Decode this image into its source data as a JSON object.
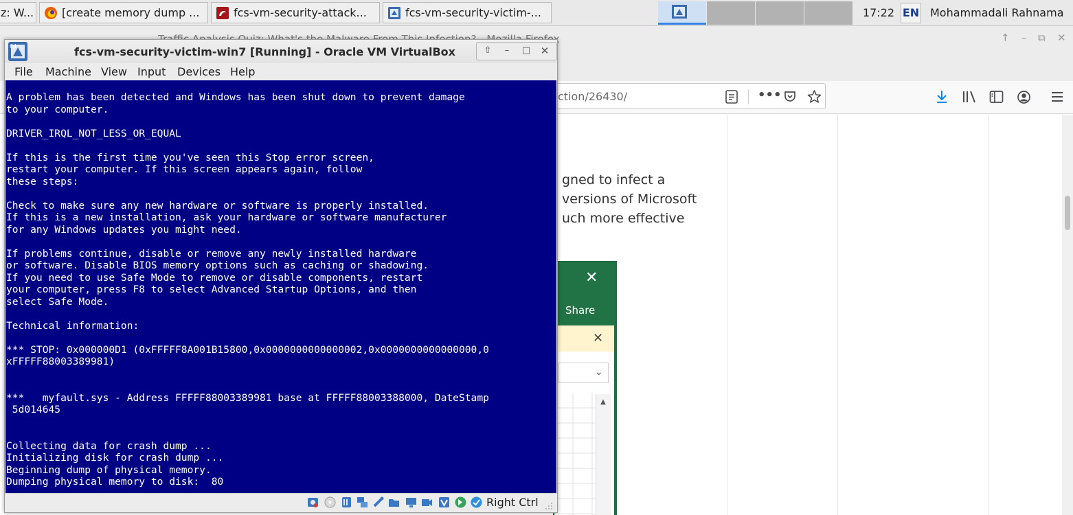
{
  "taskbar": {
    "tasks": [
      {
        "label": "z: W...",
        "icon": "window-icon"
      },
      {
        "label": "[create memory dump ...",
        "icon": "firefox-icon"
      },
      {
        "label": "fcs-vm-security-attack...",
        "icon": "kali-vm-icon"
      },
      {
        "label": "fcs-vm-security-victim-...",
        "icon": "virtualbox-icon"
      }
    ],
    "clock": "17:22",
    "lang": "EN",
    "user": "Mohammadali Rahnama"
  },
  "firefox": {
    "title": "Traffic Analysis Quiz: What's the Malware From This Infection? - Mozilla Firefox",
    "url": "ction/26430/",
    "article_lines": [
      "gned to infect a",
      "versions of Microsoft",
      "uch more effective"
    ],
    "excel": {
      "close": "✕",
      "share": "Share",
      "bar_close": "✕",
      "dropdown": "⌄",
      "scroll_up": "▲"
    }
  },
  "vbox": {
    "title": "fcs-vm-security-victim-win7 [Running] - Oracle VM VirtualBox",
    "menu": [
      "File",
      "Machine",
      "View",
      "Input",
      "Devices",
      "Help"
    ],
    "host_key": "Right Ctrl",
    "controls": {
      "up": "⇧",
      "minimize": "–",
      "maximize": "□",
      "close": "✕"
    }
  },
  "bsod": {
    "background": "#000084",
    "text": "A problem has been detected and Windows has been shut down to prevent damage\nto your computer.\n\nDRIVER_IRQL_NOT_LESS_OR_EQUAL\n\nIf this is the first time you've seen this Stop error screen,\nrestart your computer. If this screen appears again, follow\nthese steps:\n\nCheck to make sure any new hardware or software is properly installed.\nIf this is a new installation, ask your hardware or software manufacturer\nfor any Windows updates you might need.\n\nIf problems continue, disable or remove any newly installed hardware\nor software. Disable BIOS memory options such as caching or shadowing.\nIf you need to use Safe Mode to remove or disable components, restart\nyour computer, press F8 to select Advanced Startup Options, and then\nselect Safe Mode.\n\nTechnical information:\n\n*** STOP: 0x000000D1 (0xFFFFF8A001B15800,0x0000000000000002,0x0000000000000000,0\nxFFFFF88003389981)\n\n\n***   myfault.sys - Address FFFFF88003389981 base at FFFFF88003388000, DateStamp\n 5d014645\n\n\nCollecting data for crash dump ...\nInitializing disk for crash dump ...\nBeginning dump of physical memory.\nDumping physical memory to disk:  80"
  }
}
